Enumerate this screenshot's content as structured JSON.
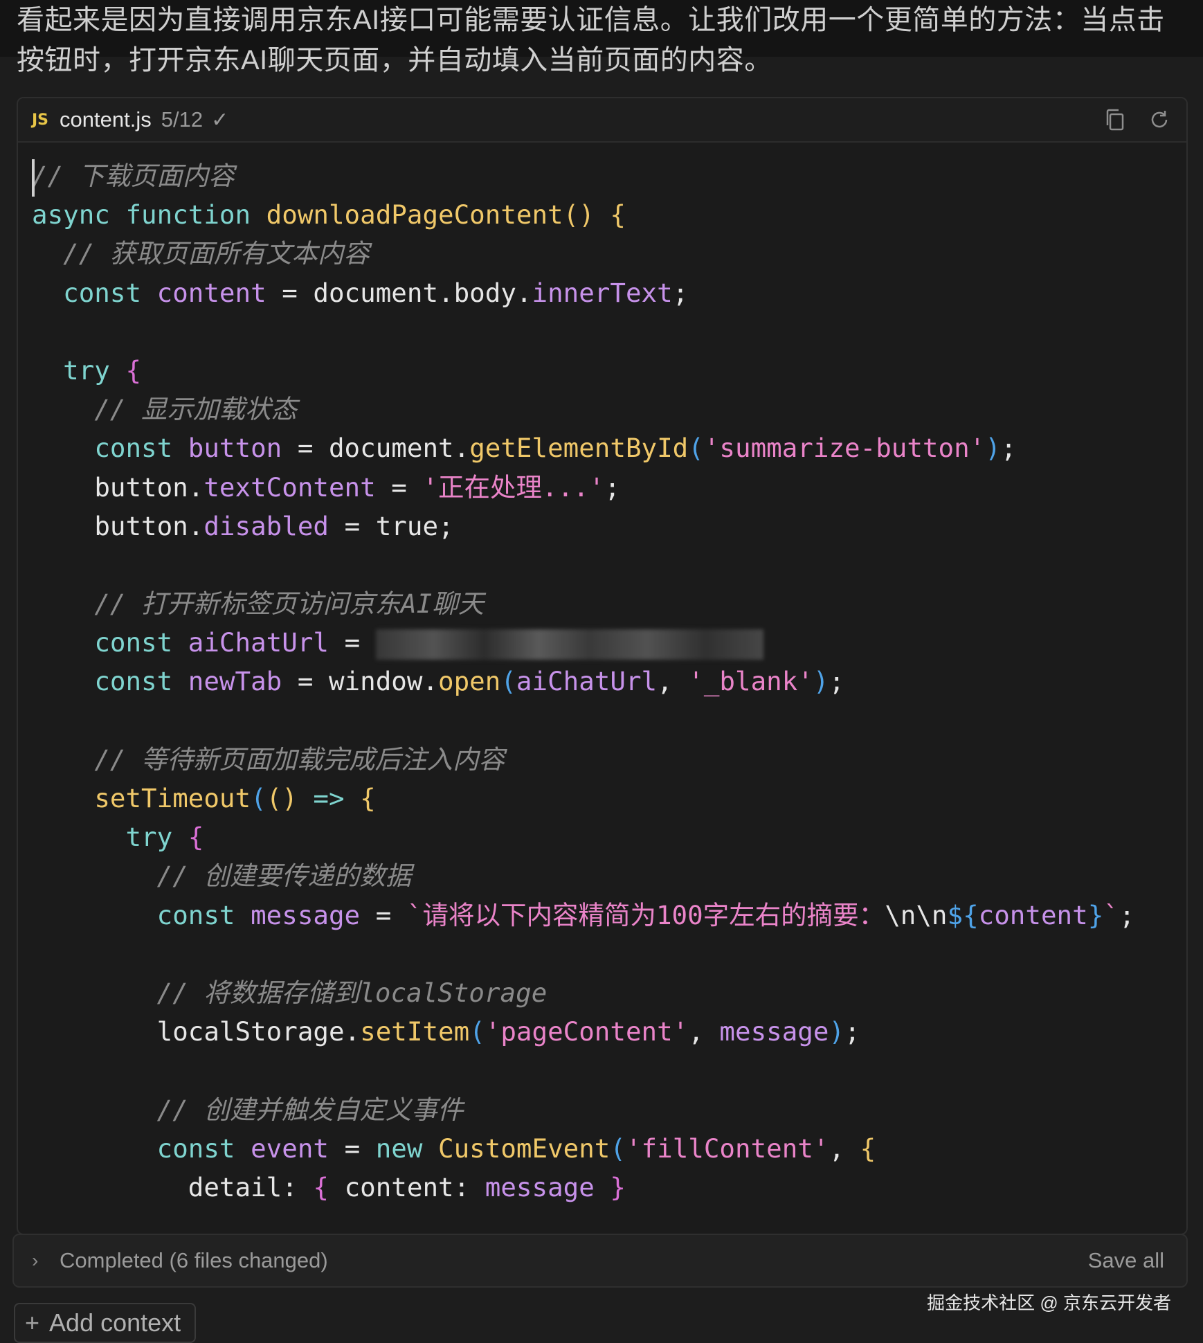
{
  "intro": {
    "text": "看起来是因为直接调用京东AI接口可能需要认证信息。让我们改用一个更简单的方法：当点击按钮时，打开京东AI聊天页面，并自动填入当前页面的内容。"
  },
  "file": {
    "badge": "JS",
    "name": "content.js",
    "progress": "5/12",
    "check": "✓",
    "copy_icon": "copy-icon",
    "refresh_icon": "refresh-icon"
  },
  "code": {
    "l1": "// 下载页面内容",
    "async_kw": "async",
    "function_kw": "function",
    "fn_name": "downloadPageContent",
    "parens": "()",
    "brace_open": "{",
    "c2": "// 获取页面所有文本内容",
    "const": "const",
    "content_var": "content",
    "eq": "=",
    "document": "document",
    "dot": ".",
    "body": "body",
    "innerText": "innerText",
    "semi": ";",
    "try": "try",
    "c3": "// 显示加载状态",
    "button_var": "button",
    "getElementById": "getElementById",
    "summarize_str": "'summarize-button'",
    "textContent": "textContent",
    "processing_str": "'正在处理...'",
    "disabled": "disabled",
    "true": "true",
    "c4": "// 打开新标签页访问京东AI聊天",
    "aiChatUrl": "aiChatUrl",
    "newTab": "newTab",
    "window": "window",
    "open": "open",
    "blank_str": "'_blank'",
    "comma": ",",
    "c5": "// 等待新页面加载完成后注入内容",
    "setTimeout": "setTimeout",
    "arrow": "=>",
    "c6": "// 创建要传递的数据",
    "message": "message",
    "tpl_start": "`请将以下内容精简为100字左右的摘要：",
    "tpl_esc": "\\n\\n",
    "tpl_dollar": "${",
    "tpl_var": "content",
    "tpl_close": "}",
    "tpl_end": "`",
    "c7": "// 将数据存储到localStorage",
    "localStorage": "localStorage",
    "setItem": "setItem",
    "pageContent_str": "'pageContent'",
    "c8": "// 创建并触发自定义事件",
    "event": "event",
    "new": "new",
    "CustomEvent": "CustomEvent",
    "fillContent_str": "'fillContent'",
    "detail": "detail",
    "colon": ":",
    "brace_close": "}",
    "last_line": "});"
  },
  "status": {
    "chevron": "›",
    "text": "Completed (6 files changed)",
    "save_all": "Save all"
  },
  "add_context": {
    "plus": "+",
    "label": "Add context"
  },
  "watermark": "掘金技术社区 @ 京东云开发者",
  "colors": {
    "background": "#1d1d1d",
    "keyword": "#7fd4cf",
    "function": "#f0c869",
    "variable": "#c792ea",
    "string": "#ea84c9",
    "comment": "#8a8a8a"
  }
}
